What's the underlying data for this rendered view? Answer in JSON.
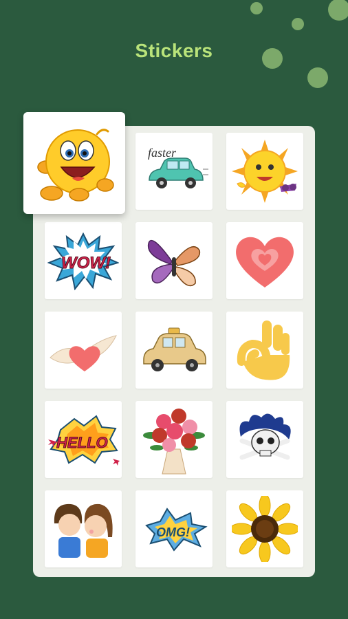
{
  "header": {
    "title": "Stickers"
  },
  "stickers": {
    "faster_text": "faster",
    "wow_text": "WOW!",
    "hello_text": "HELLO",
    "omg_text": "OMG!"
  },
  "colors": {
    "background": "#2b5a3e",
    "title": "#b9e37a",
    "panel": "#edefe9",
    "dots": "#7ca96a"
  },
  "icons": [
    "laughing-emoji-sticker",
    "faster-car-sticker",
    "sun-sunglasses-sticker",
    "wow-comic-sticker",
    "butterfly-sticker",
    "heart-sticker",
    "winged-heart-sticker",
    "taxi-sticker",
    "ok-hand-sticker",
    "hello-comic-sticker",
    "rose-bouquet-sticker",
    "skull-crossbones-sticker",
    "kissing-couple-sticker",
    "omg-comic-sticker",
    "sunflower-sticker"
  ]
}
